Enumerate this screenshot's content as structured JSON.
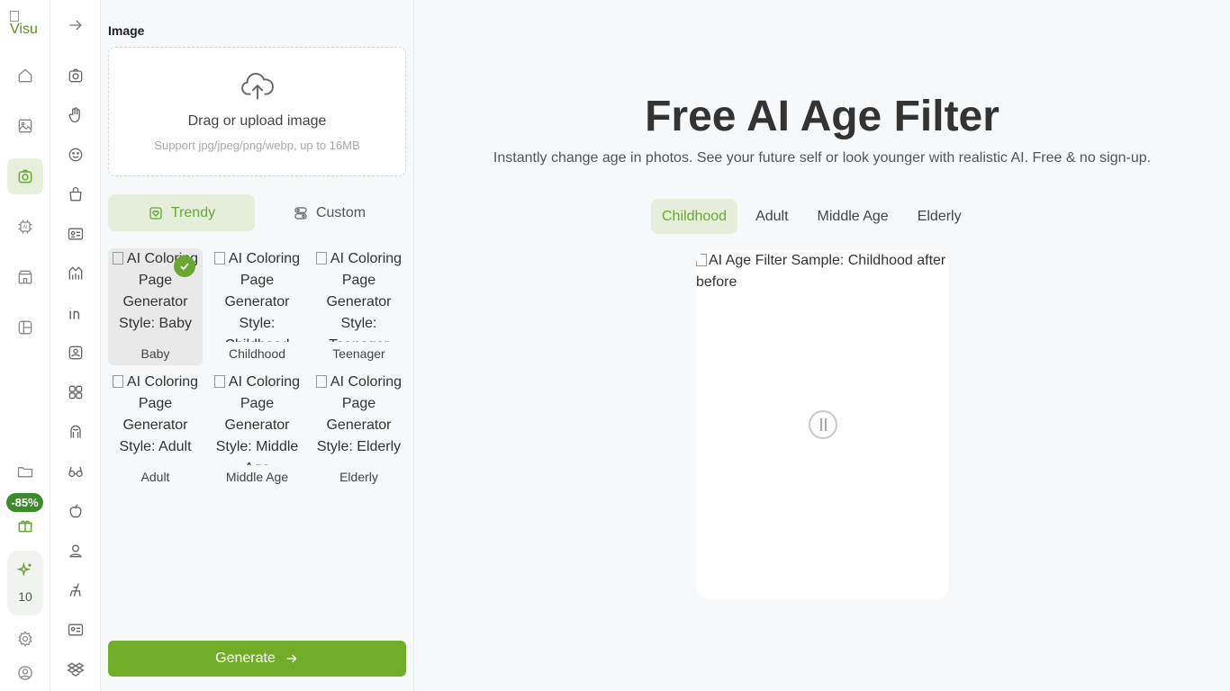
{
  "logo": {
    "alt_text": "Visu"
  },
  "rail1": {
    "badge": "-85%",
    "credits": "10"
  },
  "panel": {
    "image_label": "Image",
    "upload": {
      "title": "Drag or upload image",
      "hint": "Support jpg/jpeg/png/webp, up to 16MB"
    },
    "modes": {
      "trendy": "Trendy",
      "custom": "Custom"
    },
    "styles": [
      {
        "alt": "AI Coloring Page Generator Style: Baby",
        "label": "Baby"
      },
      {
        "alt": "AI Coloring Page Generator Style: Childhood",
        "label": "Childhood"
      },
      {
        "alt": "AI Coloring Page Generator Style: Teenager",
        "label": "Teenager"
      },
      {
        "alt": "AI Coloring Page Generator Style: Adult",
        "label": "Adult"
      },
      {
        "alt": "AI Coloring Page Generator Style: Middle Age",
        "label": "Middle Age"
      },
      {
        "alt": "AI Coloring Page Generator Style: Elderly",
        "label": "Elderly"
      }
    ],
    "generate_label": "Generate"
  },
  "main": {
    "title": "Free AI Age Filter",
    "subtitle": "Instantly change age in photos. See your future self or look younger with realistic AI. Free & no sign-up.",
    "tabs": [
      "Childhood",
      "Adult",
      "Middle Age",
      "Elderly"
    ],
    "sample_alt": "AI Age Filter Sample: Childhood after before"
  },
  "colors": {
    "accent": "#72ad2a",
    "accent_light": "#e4eedb",
    "badge": "#3d8c2b"
  }
}
